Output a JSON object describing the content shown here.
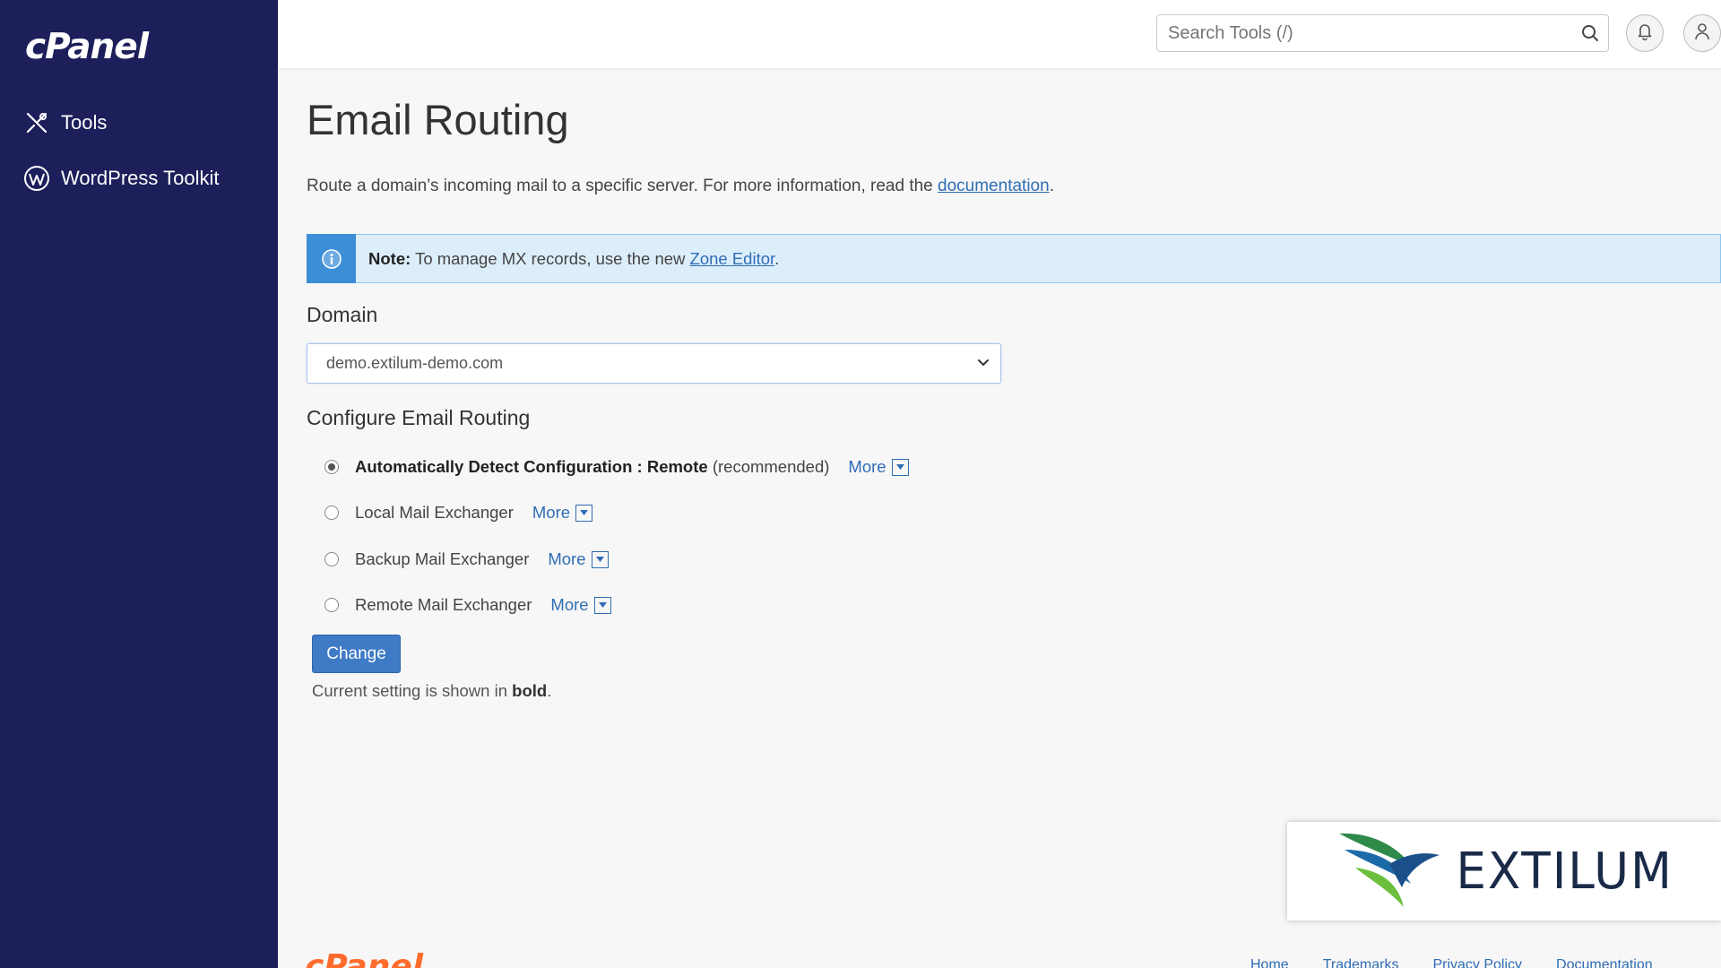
{
  "sidebar": {
    "logo": "cPanel",
    "items": [
      {
        "label": "Tools",
        "icon": "tools-icon"
      },
      {
        "label": "WordPress Toolkit",
        "icon": "wordpress-icon"
      }
    ]
  },
  "header": {
    "search_placeholder": "Search Tools (/)"
  },
  "page": {
    "title": "Email Routing",
    "intro_text": "Route a domain’s incoming mail to a specific server. For more information, read the ",
    "intro_link": "documentation",
    "intro_end": "."
  },
  "note": {
    "label": "Note:",
    "text": " To manage MX records, use the new ",
    "link": "Zone Editor",
    "end": "."
  },
  "domain": {
    "label": "Domain",
    "selected": "demo.extilum-demo.com"
  },
  "routing": {
    "title": "Configure Email Routing",
    "options": [
      {
        "label": "Automatically Detect Configuration : Remote",
        "suffix": "(recommended)",
        "more": "More",
        "checked": true
      },
      {
        "label": "Local Mail Exchanger",
        "more": "More",
        "checked": false
      },
      {
        "label": "Backup Mail Exchanger",
        "more": "More",
        "checked": false
      },
      {
        "label": "Remote Mail Exchanger",
        "more": "More",
        "checked": false
      }
    ],
    "button": "Change",
    "current_prefix": "Current setting is shown in ",
    "current_bold": "bold",
    "current_end": "."
  },
  "watermark": {
    "brand": "EXTILUM"
  },
  "footer": {
    "logo": "cPanel",
    "links": [
      "Home",
      "Trademarks",
      "Privacy Policy",
      "Documentation"
    ]
  },
  "colors": {
    "sidebar_bg": "#1c1f5a",
    "accent": "#3f7ac6",
    "link": "#2f6db5",
    "note_bg": "#ddeefb",
    "footer_logo": "#ff6c2c"
  }
}
